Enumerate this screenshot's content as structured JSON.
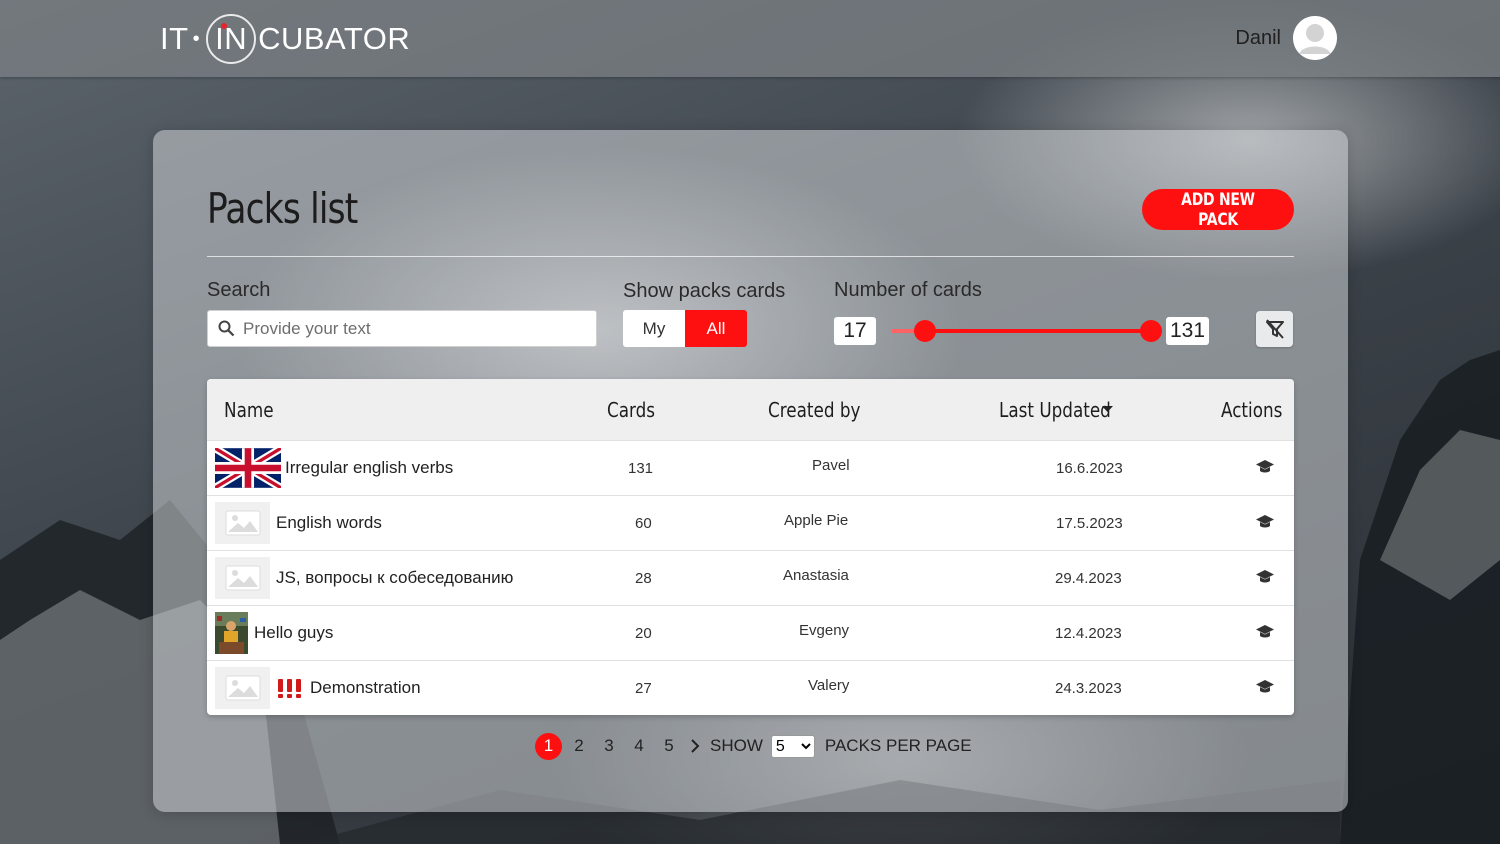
{
  "header": {
    "logo_left": "IT",
    "logo_ring": "IN",
    "logo_right": "CUBATOR",
    "user_name": "Danil"
  },
  "page": {
    "title": "Packs list",
    "add_button": "ADD NEW PACK"
  },
  "filters": {
    "search_label": "Search",
    "search_placeholder": "Provide your text",
    "show_label": "Show packs cards",
    "toggle_my": "My",
    "toggle_all": "All",
    "toggle_selected": "All",
    "cards_label": "Number of cards",
    "min_cards": "17",
    "max_cards": "131"
  },
  "table": {
    "columns": {
      "name": "Name",
      "cards": "Cards",
      "created_by": "Created by",
      "last_updated": "Last Updated",
      "actions": "Actions"
    },
    "rows": [
      {
        "name": "Irregular english verbs",
        "cards": "131",
        "created_by": "Pavel",
        "updated": "16.6.2023",
        "cover": "uk-flag"
      },
      {
        "name": "English words",
        "cards": "60",
        "created_by": "Apple Pie",
        "updated": "17.5.2023",
        "cover": "image-placeholder"
      },
      {
        "name": "JS, вопросы к собеседованию",
        "cards": "28",
        "created_by": "Anastasia",
        "updated": "29.4.2023",
        "cover": "image-placeholder"
      },
      {
        "name": "Hello guys",
        "cards": "20",
        "created_by": "Evgeny",
        "updated": "12.4.2023",
        "cover": "photo"
      },
      {
        "name": "Demonstration",
        "cards": "27",
        "created_by": "Valery",
        "updated": "24.3.2023",
        "cover": "image-placeholder"
      }
    ]
  },
  "pagination": {
    "pages": [
      "1",
      "2",
      "3",
      "4",
      "5"
    ],
    "current": "1",
    "show_label": "SHOW",
    "per_page_value": "5",
    "per_page_label": "PACKS PER PAGE"
  },
  "colors": {
    "accent": "#ff1010",
    "header_bg": "#787d82"
  }
}
